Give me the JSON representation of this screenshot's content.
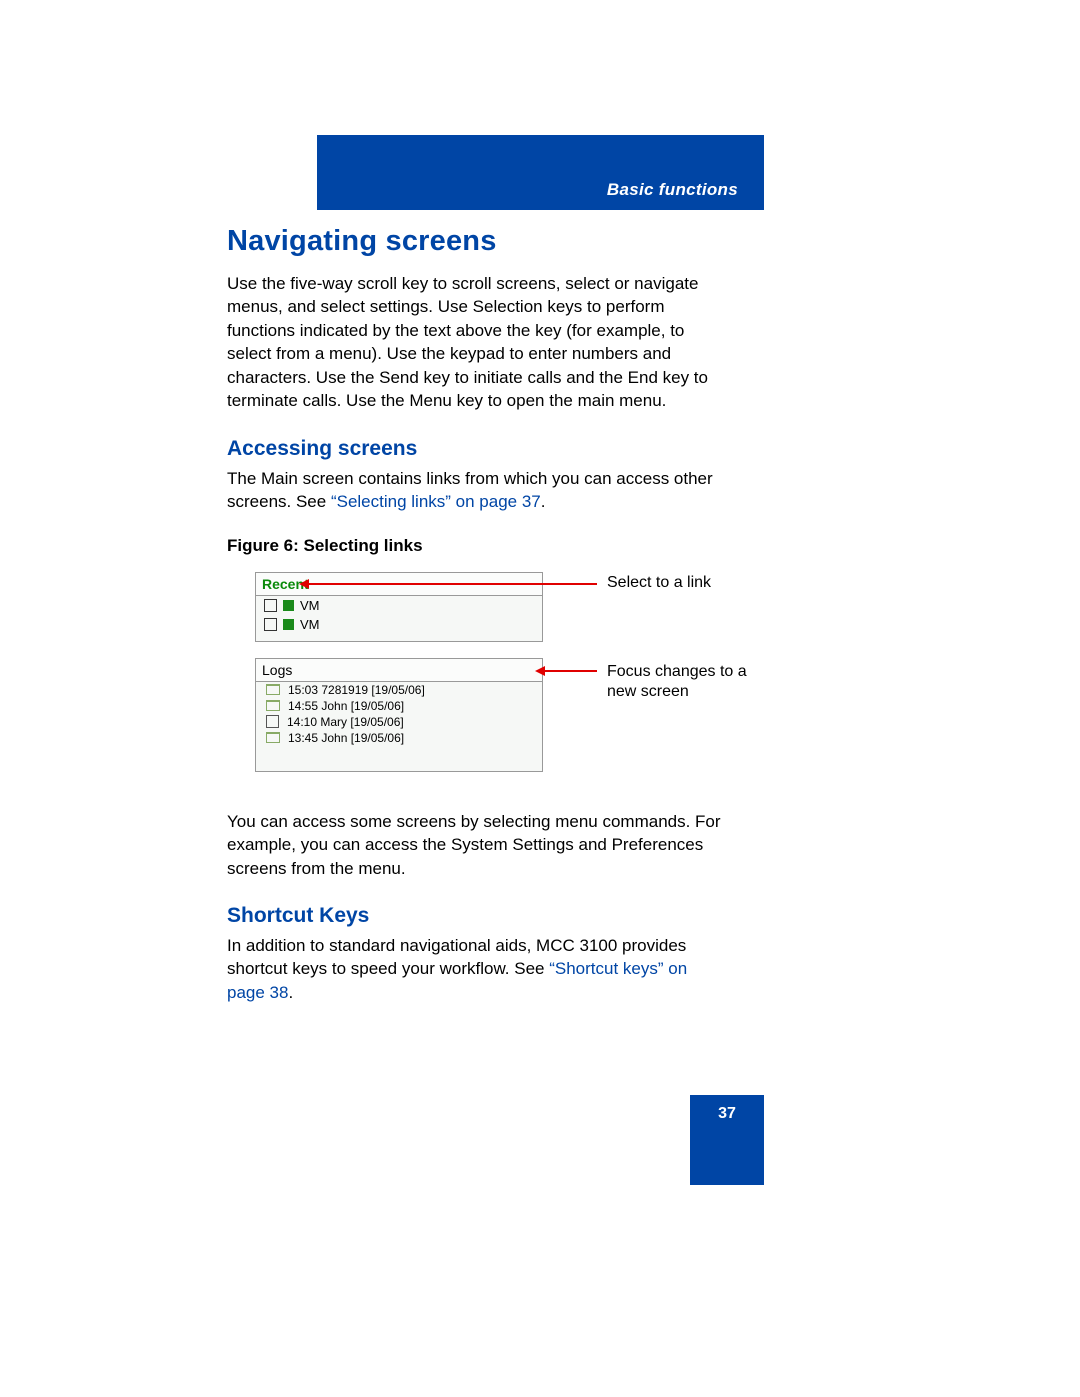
{
  "header": {
    "section_label": "Basic functions"
  },
  "title": "Navigating screens",
  "intro": "Use the five-way scroll key to scroll screens, select or navigate menus, and select settings. Use Selection keys to perform functions indicated by the text above the key (for example, to select from a menu). Use the keypad to enter numbers and characters. Use the Send key to initiate calls and the End key to terminate calls. Use the Menu key to open the main menu.",
  "sections": {
    "accessing": {
      "heading": "Accessing screens",
      "para_before_link": "The Main screen contains links from which you can access other screens. See ",
      "link_text": "“Selecting links” on page 37",
      "para_after_link": ".",
      "figure_caption": "Figure 6: Selecting links",
      "figure": {
        "recent_title": "Recent",
        "vm_label": "VM",
        "logs_title": "Logs",
        "log_rows": [
          "15:03 7281919 [19/05/06]",
          "14:55 John [19/05/06]",
          "14:10 Mary [19/05/06]",
          "13:45 John [19/05/06]"
        ],
        "annot_select": "Select to a link",
        "annot_focus": "Focus changes to a new screen"
      },
      "post_figure": "You can access some screens by selecting menu commands. For example, you can access the System Settings and Preferences screens from the menu."
    },
    "shortcut": {
      "heading": "Shortcut Keys",
      "para_before_link": "In addition to standard navigational aids, MCC 3100 provides shortcut keys to speed your workflow. See ",
      "link_text": "“Shortcut keys” on page 38",
      "para_after_link": "."
    }
  },
  "page_number": "37"
}
